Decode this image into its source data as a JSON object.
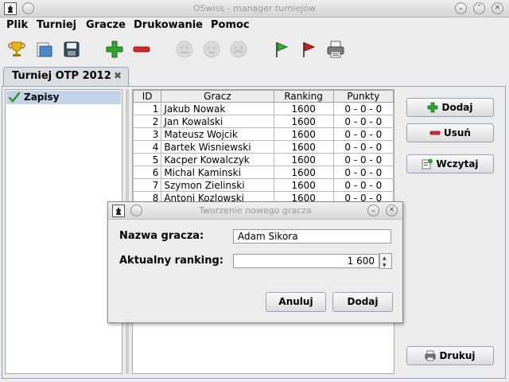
{
  "window": {
    "title": "OSwiss - manager turniejów"
  },
  "menu": [
    "Plik",
    "Turniej",
    "Gracze",
    "Drukowanie",
    "Pomoc"
  ],
  "toolbar_icons": [
    "trophy-icon",
    "open-icon",
    "save-icon",
    "add-icon",
    "remove-icon",
    "smiley-1-icon",
    "smiley-2-icon",
    "smiley-3-icon",
    "green-flag-icon",
    "red-flag-icon",
    "print-icon"
  ],
  "tab": {
    "label": "Turniej OTP 2012",
    "close": "✖"
  },
  "sidebar": {
    "items": [
      {
        "label": "Zapisy",
        "icon": "check-icon",
        "selected": true
      }
    ]
  },
  "table": {
    "columns": [
      "ID",
      "Gracz",
      "Ranking",
      "Punkty"
    ],
    "rows": [
      [
        "1",
        "Jakub Nowak",
        "1600",
        "0 - 0 - 0"
      ],
      [
        "2",
        "Jan Kowalski",
        "1600",
        "0 - 0 - 0"
      ],
      [
        "3",
        "Mateusz Wojcik",
        "1600",
        "0 - 0 - 0"
      ],
      [
        "4",
        "Bartek Wisniewski",
        "1600",
        "0 - 0 - 0"
      ],
      [
        "5",
        "Kacper Kowalczyk",
        "1600",
        "0 - 0 - 0"
      ],
      [
        "6",
        "Michal Kaminski",
        "1600",
        "0 - 0 - 0"
      ],
      [
        "7",
        "Szymon Zielinski",
        "1600",
        "0 - 0 - 0"
      ],
      [
        "8",
        "Antoni Kozlowski",
        "1600",
        "0 - 0 - 0"
      ]
    ]
  },
  "buttons": {
    "add": "Dodaj",
    "remove": "Usuń",
    "load": "Wczytaj",
    "print": "Drukuj"
  },
  "dialog": {
    "title": "Tworzenie nowego gracza",
    "name_label": "Nazwa gracza:",
    "name_value": "Adam Sikora",
    "ranking_label": "Aktualny ranking:",
    "ranking_value": "1 600",
    "cancel": "Anuluj",
    "ok": "Dodaj"
  },
  "colors": {
    "selection": "#c3d3e7",
    "tab_border": "#8fa5bd",
    "add_green": "#2fa32f",
    "remove_red": "#d62828"
  }
}
